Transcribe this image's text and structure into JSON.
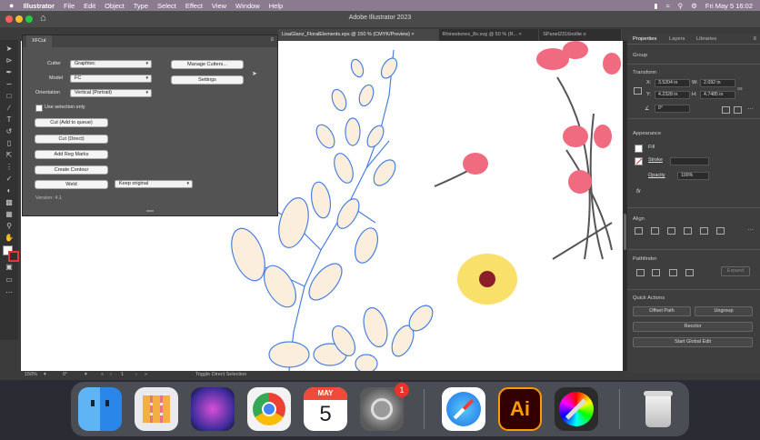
{
  "menubar": {
    "apple": "",
    "app": "Illustrator",
    "items": [
      "File",
      "Edit",
      "Object",
      "Type",
      "Select",
      "Effect",
      "View",
      "Window",
      "Help"
    ],
    "clock": "Fri May 5  16:02"
  },
  "window": {
    "title": "Adobe Illustrator 2023"
  },
  "doc_tabs": [
    "LisaGlanz_FloralElements.eps @ 150 % (CMYK/Preview)",
    "Rhinestones_8x.svg @ 50 % (R...",
    "SPanel2316nollie o"
  ],
  "xfcut": {
    "tab": "XFCut",
    "cutter_label": "Cutter",
    "cutter_value": "Graphtec",
    "model_label": "Model",
    "model_value": "FC",
    "orientation_label": "Orientation",
    "orientation_value": "Vertical (Portrait)",
    "use_selection": "Use selection only",
    "manage_cutters": "Manage Cutters...",
    "settings": "Settings",
    "cut_queue": "Cut (Add to queue)",
    "cut_direct": "Cut (Direct)",
    "add_reg_marks": "Add Reg Marks",
    "create_contour": "Create Contour",
    "weld": "Weld",
    "keep_original": "Keep original",
    "version": "Version: 4.1"
  },
  "right_panel": {
    "tabs": [
      "Properties",
      "Layers",
      "Libraries"
    ],
    "group": "Group",
    "transform": "Transform",
    "x_label": "X:",
    "x_value": "3.5204 in",
    "y_label": "Y:",
    "y_value": "4.2328 in",
    "w_label": "W:",
    "w_value": "2.092 in",
    "h_label": "H:",
    "h_value": "4.7485 in",
    "angle": "0°",
    "appearance": "Appearance",
    "fill": "Fill",
    "stroke": "Stroke",
    "opacity": "Opacity",
    "opacity_value": "100%",
    "fx": "fx",
    "align": "Align",
    "pathfinder": "Pathfinder",
    "expand": "Expand",
    "quick_actions": "Quick Actions",
    "offset_path": "Offset Path",
    "ungroup": "Ungroup",
    "recolor": "Recolor",
    "start_global_edit": "Start Global Edit"
  },
  "status": {
    "zoom": "150%",
    "angle": "0°",
    "artboard": "1",
    "tool": "Toggle Direct Selection"
  },
  "dock": {
    "apps": [
      "finder-icon",
      "launchpad-icon",
      "siri-icon",
      "chrome-icon",
      "calendar-icon",
      "settings-icon",
      "safari-icon",
      "illustrator-icon",
      "color-picker-icon",
      "trash-icon"
    ],
    "calendar_month": "MAY",
    "calendar_day": "5",
    "settings_badge": "1",
    "ai_label": "Ai"
  },
  "colors": {
    "accent": "#4a7fe0",
    "petal_pink": "#f06a80",
    "flower_yellow": "#f9e06a",
    "leaf_fill": "#fbeedd"
  }
}
